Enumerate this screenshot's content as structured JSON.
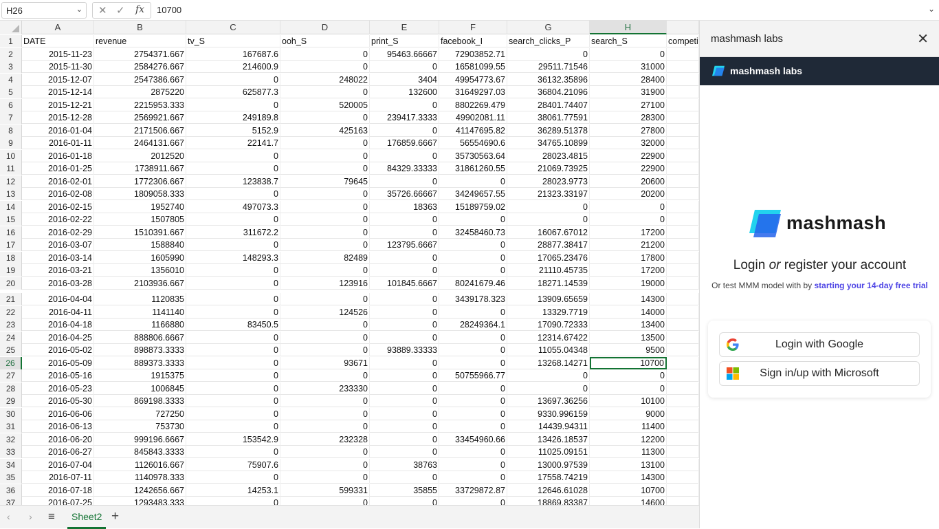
{
  "formula_bar": {
    "name_box": "H26",
    "formula_value": "10700",
    "cancel_glyph": "✕",
    "confirm_glyph": "✓",
    "fx_label": "fx"
  },
  "grid": {
    "columns": [
      {
        "letter": "A"
      },
      {
        "letter": "B"
      },
      {
        "letter": "C"
      },
      {
        "letter": "D"
      },
      {
        "letter": "E"
      },
      {
        "letter": "F"
      },
      {
        "letter": "G"
      },
      {
        "letter": "H"
      },
      {
        "letter": ""
      }
    ],
    "selected_column": "H",
    "selected_row": "26",
    "rows": [
      {
        "n": "1",
        "c": [
          "DATE",
          "revenue",
          "tv_S",
          "ooh_S",
          "print_S",
          "facebook_I",
          "search_clicks_P",
          "search_S",
          "competi"
        ]
      },
      {
        "n": "2",
        "c": [
          "2015-11-23",
          "2754371.667",
          "167687.6",
          "0",
          "95463.66667",
          "72903852.71",
          "0",
          "0",
          ""
        ]
      },
      {
        "n": "3",
        "c": [
          "2015-11-30",
          "2584276.667",
          "214600.9",
          "0",
          "0",
          "16581099.55",
          "29511.71546",
          "31000",
          ""
        ]
      },
      {
        "n": "4",
        "c": [
          "2015-12-07",
          "2547386.667",
          "0",
          "248022",
          "3404",
          "49954773.67",
          "36132.35896",
          "28400",
          ""
        ]
      },
      {
        "n": "5",
        "c": [
          "2015-12-14",
          "2875220",
          "625877.3",
          "0",
          "132600",
          "31649297.03",
          "36804.21096",
          "31900",
          ""
        ]
      },
      {
        "n": "6",
        "c": [
          "2015-12-21",
          "2215953.333",
          "0",
          "520005",
          "0",
          "8802269.479",
          "28401.74407",
          "27100",
          ""
        ]
      },
      {
        "n": "7",
        "c": [
          "2015-12-28",
          "2569921.667",
          "249189.8",
          "0",
          "239417.3333",
          "49902081.11",
          "38061.77591",
          "28300",
          ""
        ]
      },
      {
        "n": "8",
        "c": [
          "2016-01-04",
          "2171506.667",
          "5152.9",
          "425163",
          "0",
          "41147695.82",
          "36289.51378",
          "27800",
          ""
        ]
      },
      {
        "n": "9",
        "c": [
          "2016-01-11",
          "2464131.667",
          "22141.7",
          "0",
          "176859.6667",
          "56554690.6",
          "34765.10899",
          "32000",
          ""
        ]
      },
      {
        "n": "10",
        "c": [
          "2016-01-18",
          "2012520",
          "0",
          "0",
          "0",
          "35730563.64",
          "28023.4815",
          "22900",
          ""
        ]
      },
      {
        "n": "11",
        "c": [
          "2016-01-25",
          "1738911.667",
          "0",
          "0",
          "84329.33333",
          "31861260.55",
          "21069.73925",
          "22900",
          ""
        ]
      },
      {
        "n": "12",
        "c": [
          "2016-02-01",
          "1772306.667",
          "123838.7",
          "79645",
          "0",
          "0",
          "28023.9773",
          "20600",
          ""
        ]
      },
      {
        "n": "13",
        "c": [
          "2016-02-08",
          "1809058.333",
          "0",
          "0",
          "35726.66667",
          "34249657.55",
          "21323.33197",
          "20200",
          ""
        ]
      },
      {
        "n": "14",
        "c": [
          "2016-02-15",
          "1952740",
          "497073.3",
          "0",
          "18363",
          "15189759.02",
          "0",
          "0",
          ""
        ]
      },
      {
        "n": "15",
        "c": [
          "2016-02-22",
          "1507805",
          "0",
          "0",
          "0",
          "0",
          "0",
          "0",
          ""
        ]
      },
      {
        "n": "16",
        "c": [
          "2016-02-29",
          "1510391.667",
          "311672.2",
          "0",
          "0",
          "32458460.73",
          "16067.67012",
          "17200",
          ""
        ]
      },
      {
        "n": "17",
        "c": [
          "2016-03-07",
          "1588840",
          "0",
          "0",
          "123795.6667",
          "0",
          "28877.38417",
          "21200",
          ""
        ]
      },
      {
        "n": "18",
        "c": [
          "2016-03-14",
          "1605990",
          "148293.3",
          "82489",
          "0",
          "0",
          "17065.23476",
          "17800",
          ""
        ]
      },
      {
        "n": "19",
        "c": [
          "2016-03-21",
          "1356010",
          "0",
          "0",
          "0",
          "0",
          "21110.45735",
          "17200",
          ""
        ]
      },
      {
        "n": "20",
        "c": [
          "2016-03-28",
          "2103936.667",
          "0",
          "123916",
          "101845.6667",
          "80241679.46",
          "18271.14539",
          "19000",
          ""
        ]
      },
      {
        "n": "21",
        "c": [
          "2016-04-04",
          "1120835",
          "0",
          "0",
          "0",
          "3439178.323",
          "13909.65659",
          "14300",
          ""
        ]
      },
      {
        "n": "22",
        "c": [
          "2016-04-11",
          "1141140",
          "0",
          "124526",
          "0",
          "0",
          "13329.7719",
          "14000",
          ""
        ]
      },
      {
        "n": "23",
        "c": [
          "2016-04-18",
          "1166880",
          "83450.5",
          "0",
          "0",
          "28249364.1",
          "17090.72333",
          "13400",
          ""
        ]
      },
      {
        "n": "24",
        "c": [
          "2016-04-25",
          "888806.6667",
          "0",
          "0",
          "0",
          "0",
          "12314.67422",
          "13500",
          ""
        ]
      },
      {
        "n": "25",
        "c": [
          "2016-05-02",
          "898873.3333",
          "0",
          "0",
          "93889.33333",
          "0",
          "11055.04348",
          "9500",
          ""
        ]
      },
      {
        "n": "26",
        "c": [
          "2016-05-09",
          "889373.3333",
          "0",
          "93671",
          "0",
          "0",
          "13268.14271",
          "10700",
          ""
        ]
      },
      {
        "n": "27",
        "c": [
          "2016-05-16",
          "1915375",
          "0",
          "0",
          "0",
          "50755966.77",
          "0",
          "0",
          ""
        ]
      },
      {
        "n": "28",
        "c": [
          "2016-05-23",
          "1006845",
          "0",
          "233330",
          "0",
          "0",
          "0",
          "0",
          ""
        ]
      },
      {
        "n": "29",
        "c": [
          "2016-05-30",
          "869198.3333",
          "0",
          "0",
          "0",
          "0",
          "13697.36256",
          "10100",
          ""
        ]
      },
      {
        "n": "30",
        "c": [
          "2016-06-06",
          "727250",
          "0",
          "0",
          "0",
          "0",
          "9330.996159",
          "9000",
          ""
        ]
      },
      {
        "n": "31",
        "c": [
          "2016-06-13",
          "753730",
          "0",
          "0",
          "0",
          "0",
          "14439.94311",
          "11400",
          ""
        ]
      },
      {
        "n": "32",
        "c": [
          "2016-06-20",
          "999196.6667",
          "153542.9",
          "232328",
          "0",
          "33454960.66",
          "13426.18537",
          "12200",
          ""
        ]
      },
      {
        "n": "33",
        "c": [
          "2016-06-27",
          "845843.3333",
          "0",
          "0",
          "0",
          "0",
          "11025.09151",
          "11300",
          ""
        ]
      },
      {
        "n": "34",
        "c": [
          "2016-07-04",
          "1126016.667",
          "75907.6",
          "0",
          "38763",
          "0",
          "13000.97539",
          "13100",
          ""
        ]
      },
      {
        "n": "35",
        "c": [
          "2016-07-11",
          "1140978.333",
          "0",
          "0",
          "0",
          "0",
          "17558.74219",
          "14300",
          ""
        ]
      },
      {
        "n": "36",
        "c": [
          "2016-07-18",
          "1242656.667",
          "14253.1",
          "599331",
          "35855",
          "33729872.87",
          "12646.61028",
          "10700",
          ""
        ]
      },
      {
        "n": "37",
        "c": [
          "2016-07-25",
          "1293483.333",
          "0",
          "0",
          "0",
          "0",
          "18869.83387",
          "14600",
          ""
        ]
      }
    ]
  },
  "sheet_tabs": {
    "prev_glyph": "‹",
    "next_glyph": "›",
    "menu_glyph": "≡",
    "active_sheet": "Sheet2",
    "add_glyph": "+"
  },
  "panel": {
    "header_title": "mashmash labs",
    "close_glyph": "✕",
    "brand_bar_title": "mashmash labs",
    "logo_name": "mashmash",
    "login_title_pre": "Login ",
    "login_title_em": "or",
    "login_title_post": " register your account",
    "sub_text": "Or test MMM model with by ",
    "trial_link": "starting your 14-day free trial",
    "google_button": "Login with Google",
    "microsoft_button": "Sign in/up with Microsoft",
    "colors": {
      "brand_bar": "#1f2937",
      "logo_cyan": "#22d3ee",
      "logo_blue": "#2563eb",
      "link": "#4f46e5",
      "excel_green": "#137333"
    }
  }
}
